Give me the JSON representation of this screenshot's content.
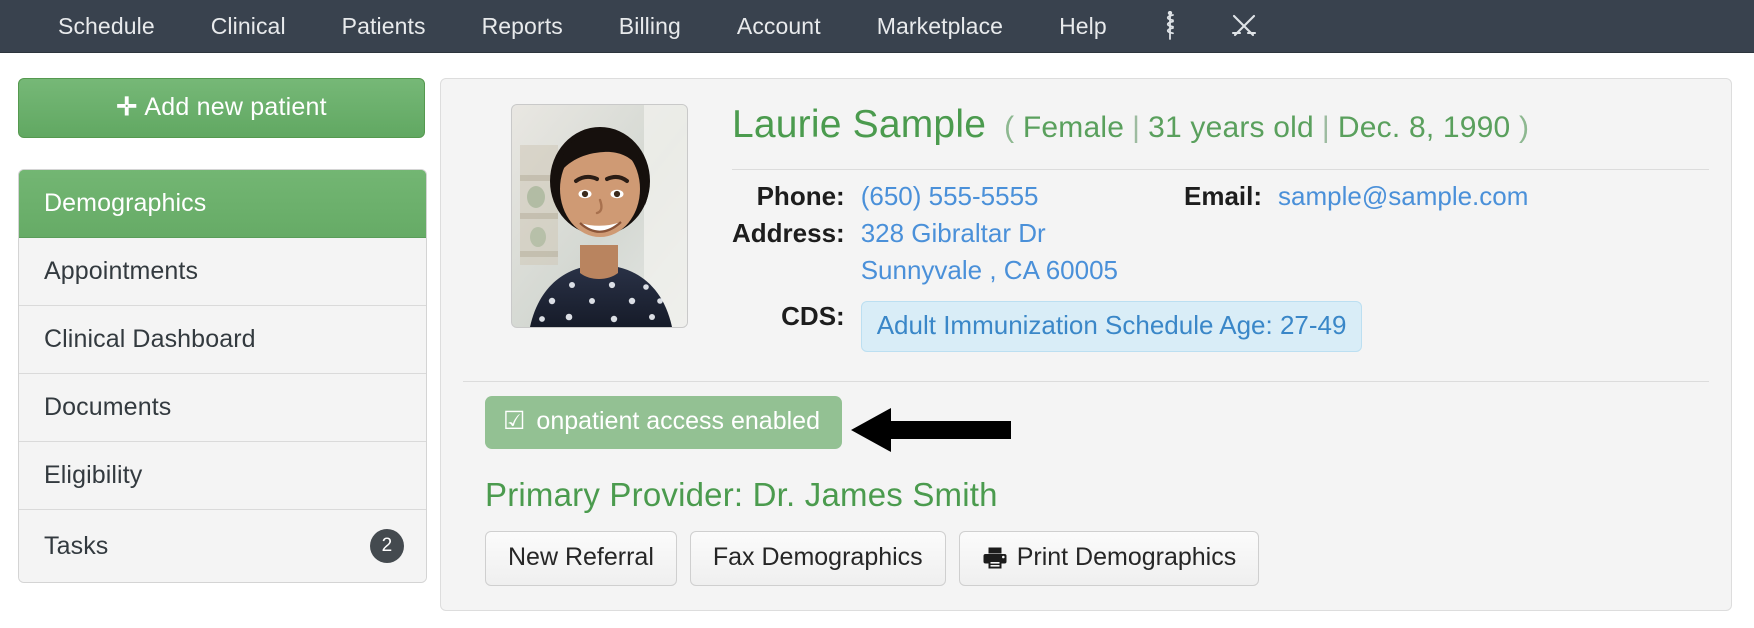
{
  "topnav": {
    "items": [
      {
        "label": "Schedule"
      },
      {
        "label": "Clinical"
      },
      {
        "label": "Patients"
      },
      {
        "label": "Reports"
      },
      {
        "label": "Billing"
      },
      {
        "label": "Account"
      },
      {
        "label": "Marketplace"
      },
      {
        "label": "Help"
      }
    ],
    "icons": [
      {
        "name": "rod-of-asclepius-icon"
      },
      {
        "name": "crossed-swords-icon"
      }
    ],
    "background_color": "#39424e",
    "text_color": "#e8eaec"
  },
  "sidebar": {
    "add_patient_label": "Add new patient",
    "add_patient_plus": "✛",
    "items": [
      {
        "label": "Demographics",
        "active": true,
        "badge": ""
      },
      {
        "label": "Appointments",
        "active": false,
        "badge": ""
      },
      {
        "label": "Clinical Dashboard",
        "active": false,
        "badge": ""
      },
      {
        "label": "Documents",
        "active": false,
        "badge": ""
      },
      {
        "label": "Eligibility",
        "active": false,
        "badge": ""
      },
      {
        "label": "Tasks",
        "active": false,
        "badge": "2"
      }
    ],
    "accent_color": "#6bb06b"
  },
  "patient": {
    "name": "Laurie Sample",
    "meta_open": "(",
    "gender": "Female",
    "age": "31 years old",
    "dob": "Dec. 8, 1990",
    "meta_close": ")",
    "separator": "|",
    "photo_alt": "patient-photo",
    "details": {
      "phone_label": "Phone:",
      "phone_value": "(650) 555-5555",
      "email_label": "Email:",
      "email_value": "sample@sample.com",
      "address_label": "Address:",
      "address_line1": "328 Gibraltar Dr",
      "address_line2": "Sunnyvale , CA 60005",
      "cds_label": "CDS:",
      "cds_value": "Adult Immunization Schedule Age: 27-49"
    },
    "access_badge": {
      "check_glyph": "☑",
      "label": "onpatient access enabled",
      "color": "#93c193"
    },
    "provider_line": "Primary Provider: Dr. James Smith",
    "buttons": [
      {
        "label": "New Referral",
        "icon": ""
      },
      {
        "label": "Fax Demographics",
        "icon": ""
      },
      {
        "label": "Print Demographics",
        "icon": "printer-icon"
      }
    ]
  },
  "annotation": {
    "arrow": "black-left-arrow pointing at onpatient access enabled badge"
  },
  "colors": {
    "green": "#4b9b4e",
    "link_blue": "#4a90d9",
    "cds_blue_bg": "#d9edf7",
    "navy": "#39424e"
  }
}
